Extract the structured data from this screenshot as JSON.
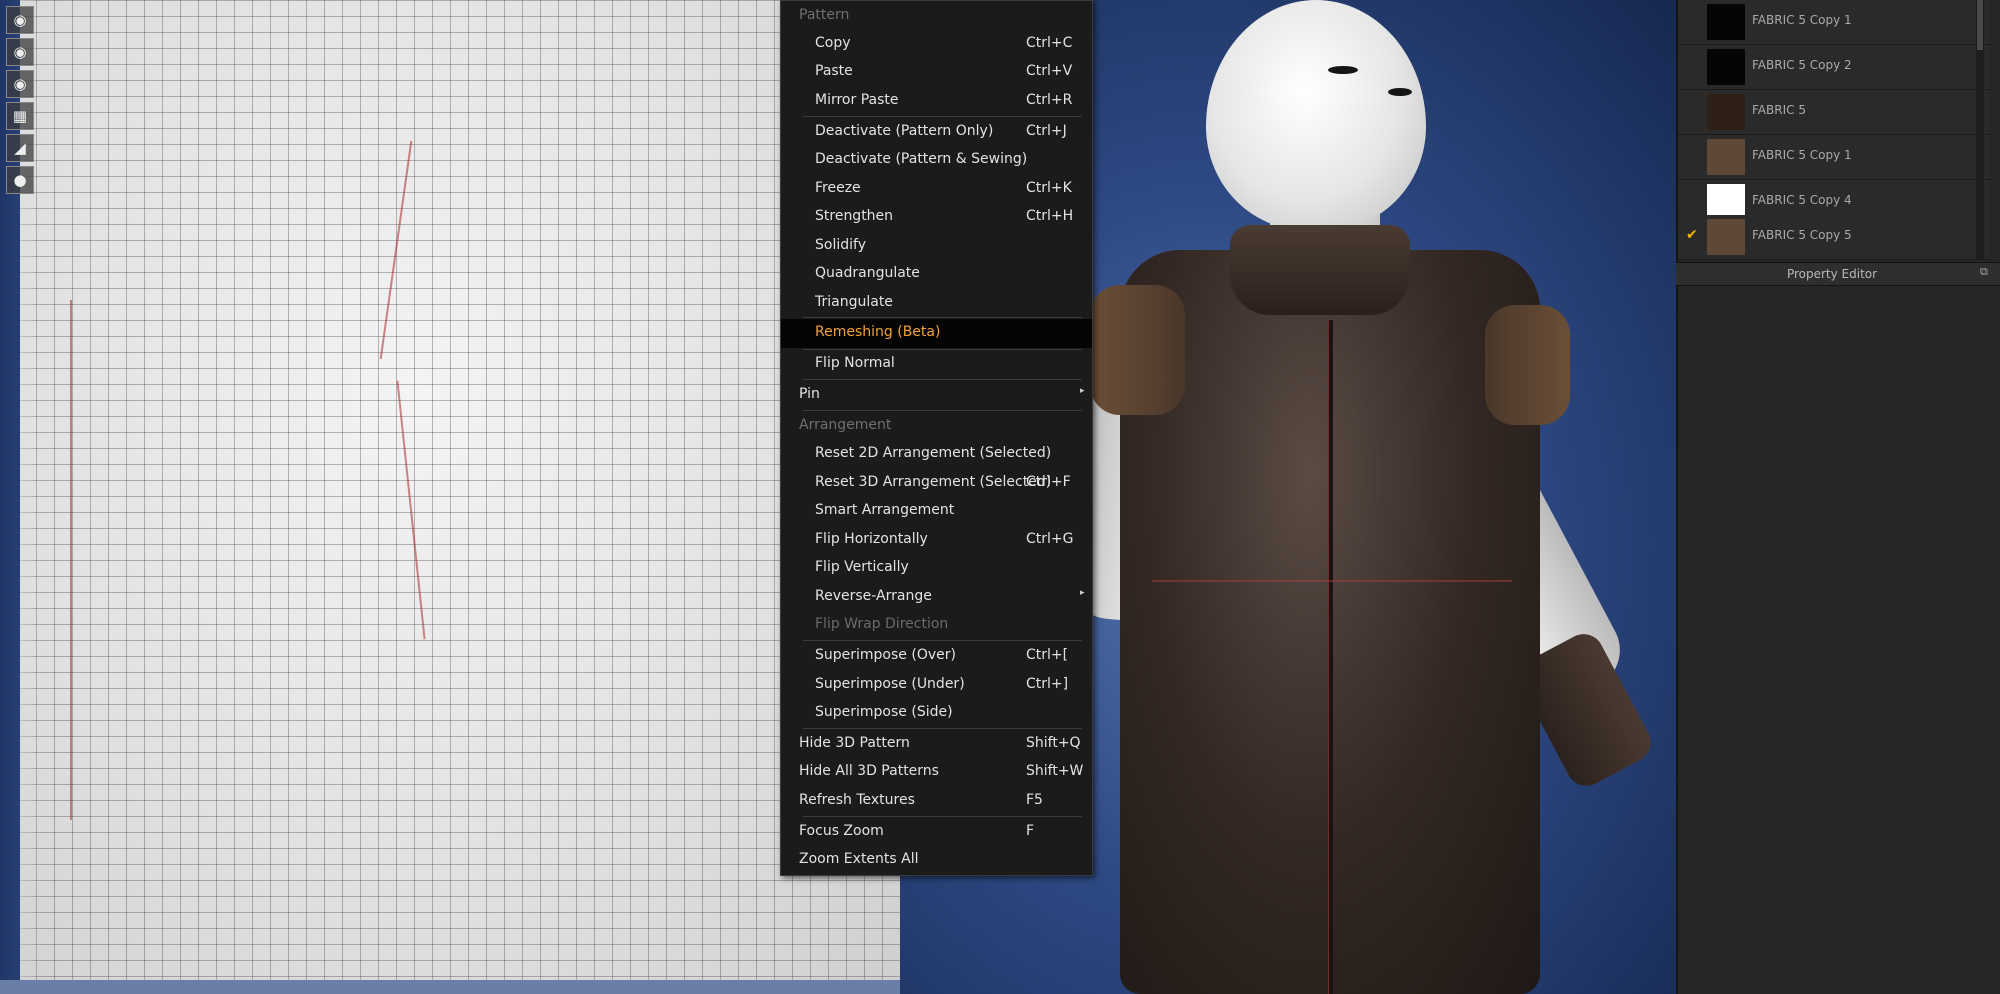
{
  "menu": {
    "pattern_header": "Pattern",
    "copy": {
      "label": "Copy",
      "shortcut": "Ctrl+C"
    },
    "paste": {
      "label": "Paste",
      "shortcut": "Ctrl+V"
    },
    "mirror_paste": {
      "label": "Mirror Paste",
      "shortcut": "Ctrl+R"
    },
    "deactivate_pattern_only": {
      "label": "Deactivate (Pattern Only)",
      "shortcut": "Ctrl+J"
    },
    "deactivate_pattern_sewing": {
      "label": "Deactivate (Pattern & Sewing)"
    },
    "freeze": {
      "label": "Freeze",
      "shortcut": "Ctrl+K"
    },
    "strengthen": {
      "label": "Strengthen",
      "shortcut": "Ctrl+H"
    },
    "solidify": {
      "label": "Solidify"
    },
    "quadrangulate": {
      "label": "Quadrangulate"
    },
    "triangulate": {
      "label": "Triangulate"
    },
    "remeshing": {
      "label": "Remeshing (Beta)"
    },
    "flip_normal": {
      "label": "Flip Normal"
    },
    "pin": {
      "label": "Pin"
    },
    "arrangement_header": "Arrangement",
    "reset_2d": {
      "label": "Reset 2D Arrangement (Selected)"
    },
    "reset_3d": {
      "label": "Reset 3D Arrangement (Selected)",
      "shortcut": "Ctrl+F"
    },
    "smart_arrangement": {
      "label": "Smart Arrangement"
    },
    "flip_horizontally": {
      "label": "Flip Horizontally",
      "shortcut": "Ctrl+G"
    },
    "flip_vertically": {
      "label": "Flip Vertically"
    },
    "reverse_arrange": {
      "label": "Reverse-Arrange"
    },
    "flip_wrap_direction": {
      "label": "Flip Wrap Direction"
    },
    "superimpose_over": {
      "label": "Superimpose (Over)",
      "shortcut": "Ctrl+["
    },
    "superimpose_under": {
      "label": "Superimpose (Under)",
      "shortcut": "Ctrl+]"
    },
    "superimpose_side": {
      "label": "Superimpose (Side)"
    },
    "hide_3d_pattern": {
      "label": "Hide 3D Pattern",
      "shortcut": "Shift+Q"
    },
    "hide_all_3d_patterns": {
      "label": "Hide All 3D Patterns",
      "shortcut": "Shift+W"
    },
    "refresh_textures": {
      "label": "Refresh Textures",
      "shortcut": "F5"
    },
    "focus_zoom": {
      "label": "Focus Zoom",
      "shortcut": "F"
    },
    "zoom_extents_all": {
      "label": "Zoom Extents All"
    }
  },
  "fabric_list": [
    {
      "name": "FABRIC 5 Copy 1",
      "color": "#050505",
      "checked": false
    },
    {
      "name": "FABRIC 5 Copy 2",
      "color": "#050505",
      "checked": false
    },
    {
      "name": "FABRIC 5",
      "color": "#2e2017",
      "checked": false
    },
    {
      "name": "FABRIC 5 Copy 1",
      "color": "#5e4838",
      "checked": false
    },
    {
      "name": "FABRIC 5 Copy 4",
      "color": "#ffffff",
      "checked": false
    },
    {
      "name": "FABRIC 5 Copy 5",
      "color": "#5e4838",
      "checked": true
    }
  ],
  "property_editor": {
    "title": "Property Editor"
  },
  "icons": {
    "check": "checkmark-icon",
    "submenu": "submenu-arrow-icon",
    "popout": "popout-icon"
  },
  "colors": {
    "highlight_text": "#f3a23b",
    "check": "#f0b400"
  }
}
